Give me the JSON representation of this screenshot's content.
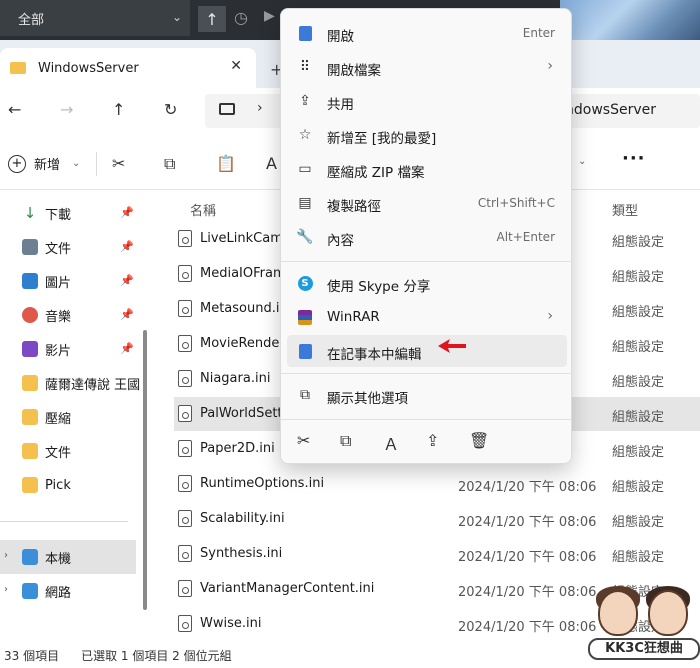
{
  "topbar": {
    "scope_label": "全部"
  },
  "tab": {
    "title": "WindowsServer"
  },
  "address": {
    "crumb_tail": "ndowsServer"
  },
  "toolbar": {
    "new_label": "新增"
  },
  "sidebar": {
    "items": [
      {
        "label": "下載",
        "icon": "download-icon",
        "pinned": true
      },
      {
        "label": "文件",
        "icon": "document-icon",
        "pinned": true
      },
      {
        "label": "圖片",
        "icon": "picture-icon",
        "pinned": true
      },
      {
        "label": "音樂",
        "icon": "music-icon",
        "pinned": true
      },
      {
        "label": "影片",
        "icon": "video-icon",
        "pinned": true
      },
      {
        "label": "薩爾達傳說 王國",
        "icon": "folder-icon",
        "pinned": false
      },
      {
        "label": "壓縮",
        "icon": "folder-icon",
        "pinned": false
      },
      {
        "label": "文件",
        "icon": "folder-icon",
        "pinned": false
      },
      {
        "label": "Pick",
        "icon": "folder-icon",
        "pinned": false
      }
    ],
    "this_pc": "本機",
    "network": "網路"
  },
  "columns": {
    "name": "名稱",
    "type": "類型"
  },
  "files": [
    {
      "name": "LiveLinkCame",
      "date": "06",
      "type": "組態設定"
    },
    {
      "name": "MediaIOFram",
      "date": "06",
      "type": "組態設定"
    },
    {
      "name": "Metasound.ir",
      "date": "06",
      "type": "組態設定"
    },
    {
      "name": "MovieRende",
      "date": "06",
      "type": "組態設定"
    },
    {
      "name": "Niagara.ini",
      "date": "06",
      "type": "組態設定"
    },
    {
      "name": "PalWorldSett",
      "date": "06",
      "type": "組態設定"
    },
    {
      "name": "Paper2D.ini",
      "date": "06",
      "type": "組態設定"
    },
    {
      "name": "RuntimeOptions.ini",
      "date": "2024/1/20 下午 08:06",
      "type": "組態設定"
    },
    {
      "name": "Scalability.ini",
      "date": "2024/1/20 下午 08:06",
      "type": "組態設定"
    },
    {
      "name": "Synthesis.ini",
      "date": "2024/1/20 下午 08:06",
      "type": "組態設定"
    },
    {
      "name": "VariantManagerContent.ini",
      "date": "2024/1/20 下午 08:06",
      "type": "組態設定"
    },
    {
      "name": "Wwise.ini",
      "date": "2024/1/20 下午 08:06",
      "type": "組態設定"
    }
  ],
  "status": {
    "count": "33 個項目",
    "selected": "已選取 1 個項目 2 個位元組"
  },
  "context_menu": {
    "items": [
      {
        "label": "開啟",
        "shortcut": "Enter",
        "icon": "notepad-icon"
      },
      {
        "label": "開啟檔案",
        "submenu": true,
        "icon": "open-with-icon"
      },
      {
        "label": "共用",
        "icon": "share-icon"
      },
      {
        "label": "新增至 [我的最愛]",
        "icon": "star-icon"
      },
      {
        "label": "壓縮成 ZIP 檔案",
        "icon": "zip-icon"
      },
      {
        "label": "複製路徑",
        "shortcut": "Ctrl+Shift+C",
        "icon": "copy-path-icon"
      },
      {
        "label": "內容",
        "shortcut": "Alt+Enter",
        "icon": "wrench-icon"
      },
      {
        "label": "使用 Skype 分享",
        "icon": "skype-icon"
      },
      {
        "label": "WinRAR",
        "submenu": true,
        "icon": "winrar-icon"
      },
      {
        "label": "在記事本中編輯",
        "icon": "notepad-icon",
        "highlighted": true
      },
      {
        "label": "顯示其他選項",
        "icon": "more-options-icon"
      }
    ]
  },
  "watermark": {
    "text": "KK3C狂想曲"
  },
  "colors": {
    "annotation_arrow": "#e0141e",
    "folder": "#f4c04e",
    "notepad": "#3b7ad8"
  }
}
